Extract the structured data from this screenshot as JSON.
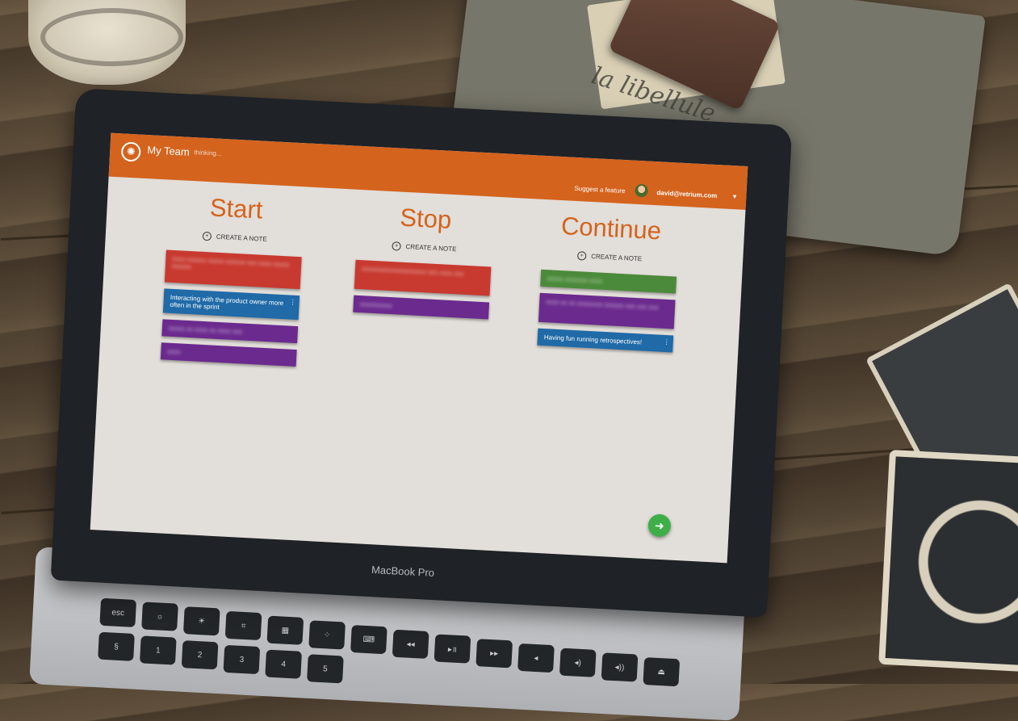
{
  "app": {
    "title": "My Team",
    "status": "thinking...",
    "logo_icon": "shutter-icon"
  },
  "header": {
    "suggest_label": "Suggest a feature",
    "user_email": "david@retrium.com",
    "menu_icon": "chevron-down-icon"
  },
  "columns": [
    {
      "title": "Start",
      "create_label": "CREATE A NOTE",
      "notes": [
        {
          "text": "",
          "color": "#c8392f",
          "blurred": true
        },
        {
          "text": "Interacting with the product owner more often in the sprint",
          "color": "#1f6aa7",
          "blurred": false
        },
        {
          "text": "",
          "color": "#6b2a8e",
          "blurred": true
        },
        {
          "text": "",
          "color": "#6b2a8e",
          "blurred": true
        }
      ]
    },
    {
      "title": "Stop",
      "create_label": "CREATE A NOTE",
      "notes": [
        {
          "text": "",
          "color": "#c8392f",
          "blurred": true
        },
        {
          "text": "",
          "color": "#6b2a8e",
          "blurred": true
        }
      ]
    },
    {
      "title": "Continue",
      "create_label": "CREATE A NOTE",
      "notes": [
        {
          "text": "",
          "color": "#4b8a3a",
          "blurred": true
        },
        {
          "text": "",
          "color": "#6b2a8e",
          "blurred": true
        },
        {
          "text": "Having fun running retrospectives!",
          "color": "#1f6aa7",
          "blurred": false
        }
      ]
    }
  ],
  "fab": {
    "icon": "arrow-right-icon",
    "color": "#3eae49"
  },
  "laptop": {
    "brand": "MacBook Pro"
  },
  "colors": {
    "accent": "#d4631d",
    "background": "#e2ded9"
  }
}
